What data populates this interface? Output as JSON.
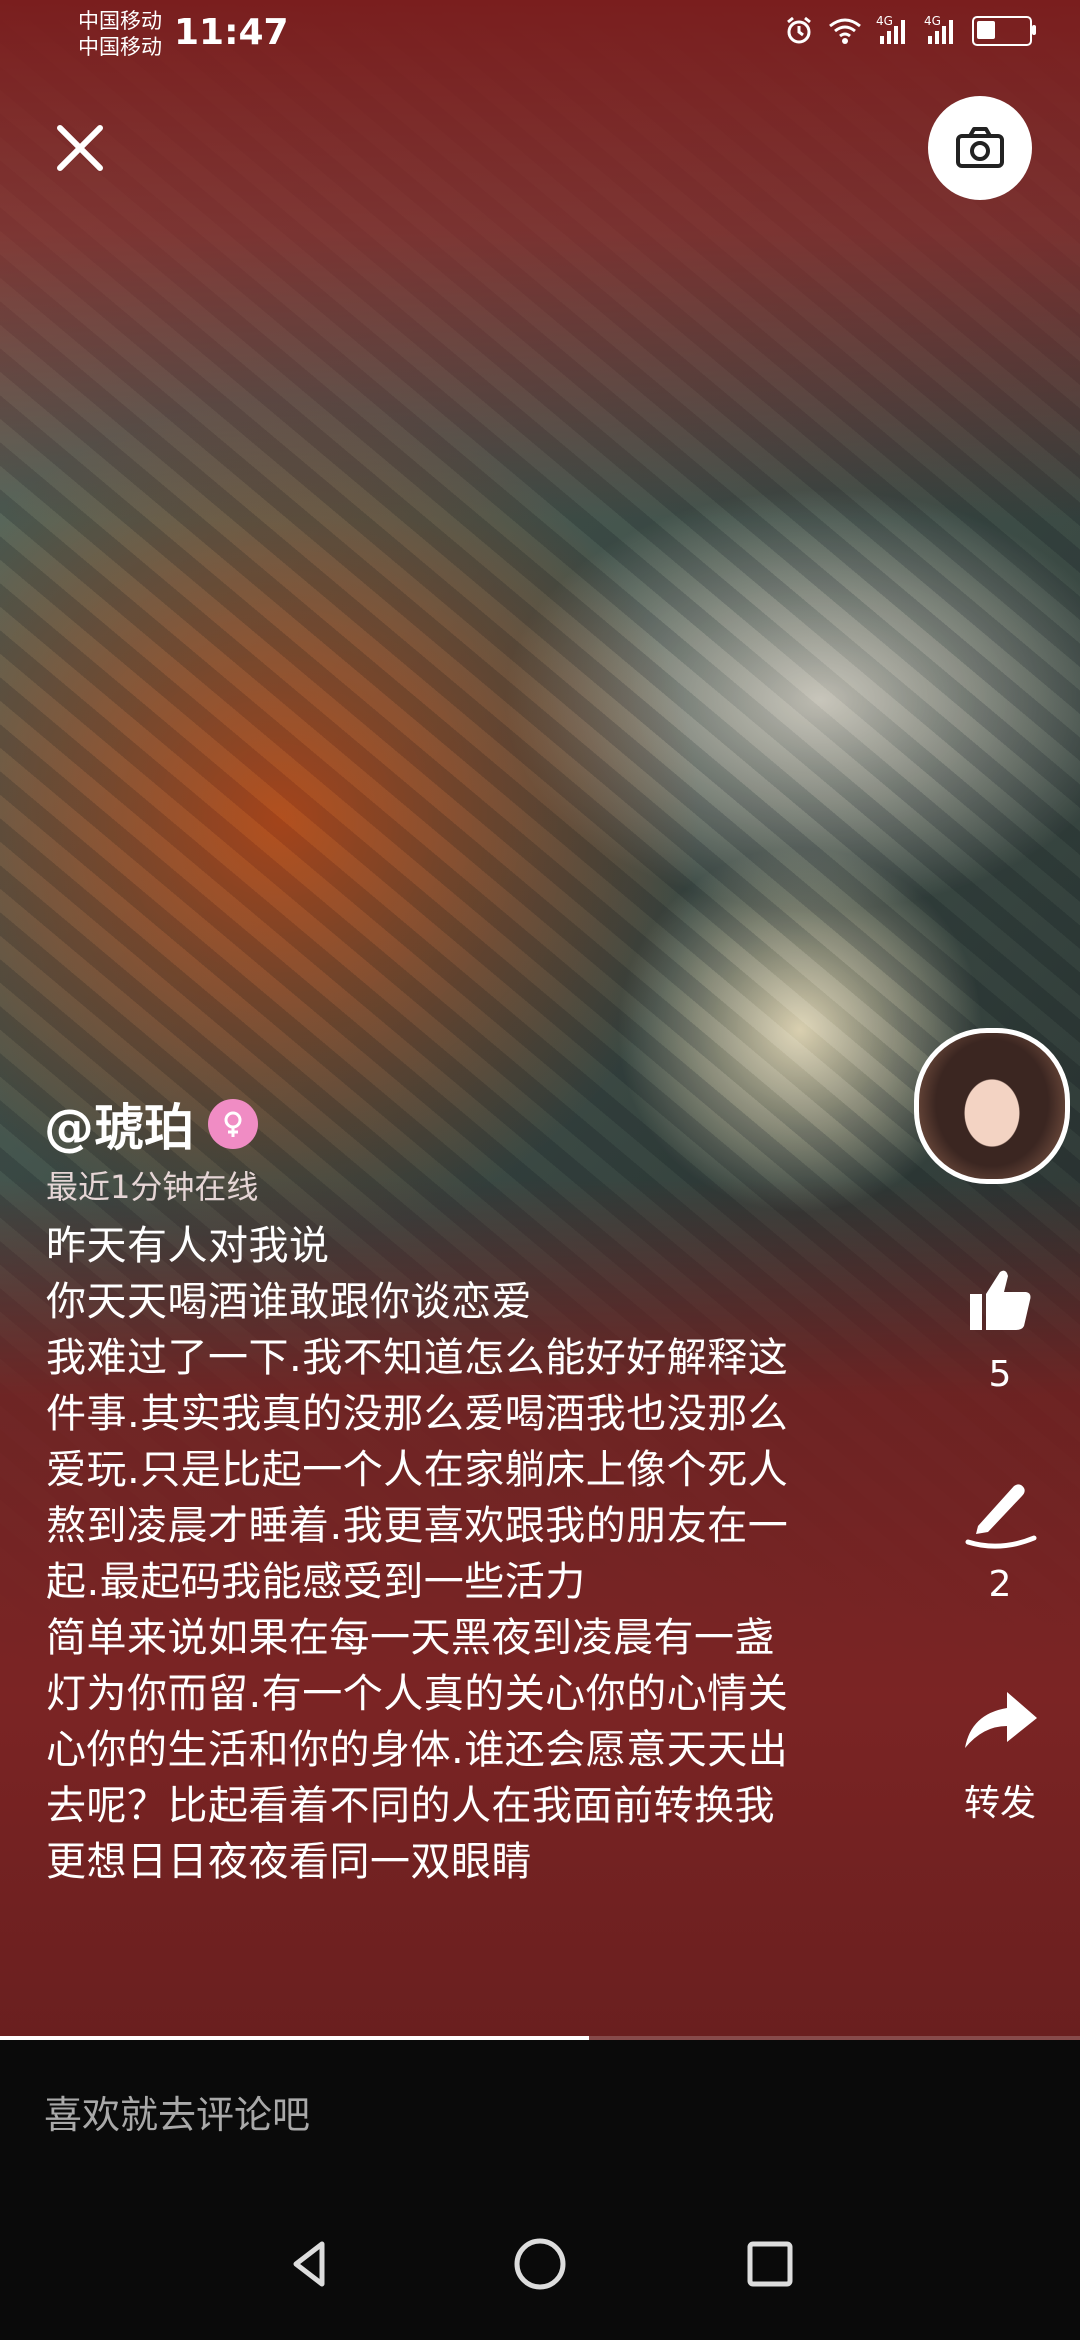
{
  "status_bar": {
    "carrier_1": "中国移动",
    "carrier_2": "中国移动",
    "time": "11:47",
    "network_1": "4G",
    "network_2": "4G",
    "battery_level": 0.35
  },
  "header": {
    "close_icon": "close-icon",
    "camera_icon": "camera-icon"
  },
  "author": {
    "username": "@琥珀",
    "online_status": "最近1分钟在线",
    "gender_badge": "female-icon"
  },
  "post": {
    "text": "昨天有人对我说\n你天天喝酒谁敢跟你谈恋爱\n我难过了一下.我不知道怎么能好好解释这件事.其实我真的没那么爱喝酒我也没那么爱玩.只是比起一个人在家躺床上像个死人熬到凌晨才睡着.我更喜欢跟我的朋友在一起.最起码我能感受到一些活力\n简单来说如果在每一天黑夜到凌晨有一盏灯为你而留.有一个人真的关心你的心情关心你的生活和你的身体.谁还会愿意天天出去呢？比起看着不同的人在我面前转换我更想日日夜夜看同一双眼睛"
  },
  "actions": {
    "like_count": "5",
    "comment_count": "2",
    "share_label": "转发"
  },
  "progress": {
    "fraction": 0.545
  },
  "comment_bar": {
    "placeholder": "喜欢就去评论吧"
  }
}
